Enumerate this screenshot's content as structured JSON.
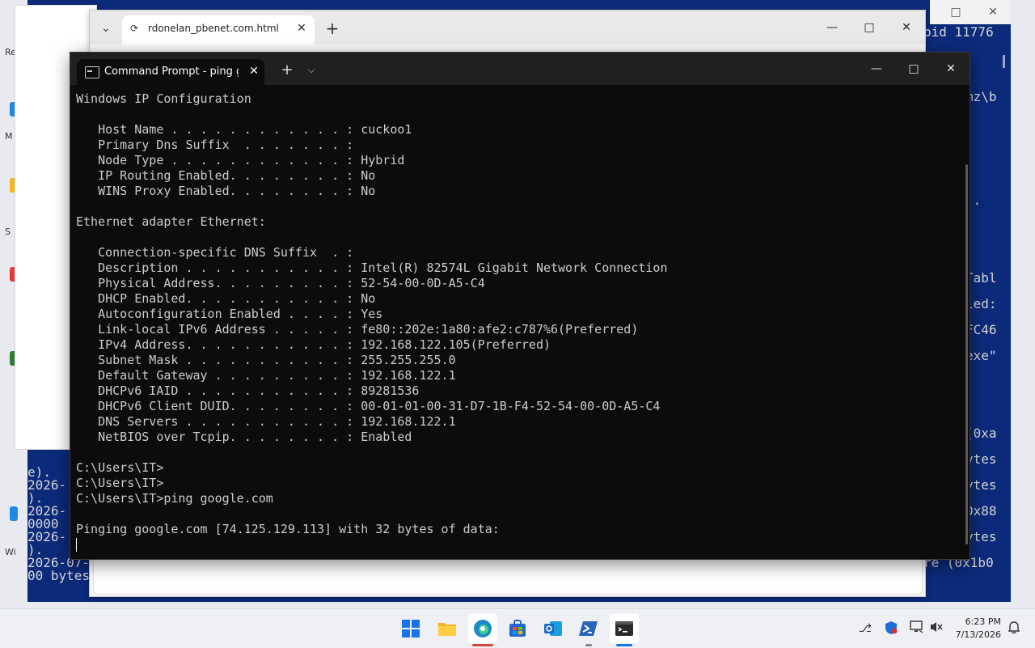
{
  "desktop": {
    "labels": [
      "Re",
      "M",
      "S",
      "Wi"
    ]
  },
  "background_terminal": {
    "right_fragments": [
      "pid 11776",
      "mz\\b",
      ".",
      "'.",
      "Tabl",
      "led:",
      "FC46",
      "exe\"",
      "(0xa",
      "ytes",
      "ytes",
      "0x88",
      "ytes",
      "re (0x1b0"
    ],
    "left_fragments": [
      "e).",
      "2026-",
      ").",
      "2026-",
      "0000",
      "2026-",
      ").",
      "2026-07-",
      "00 bytes"
    ],
    "controls": {
      "maximize": "□",
      "close": "✕"
    }
  },
  "browser": {
    "tab_title": "rdonelan_pbenet.com.html",
    "new_tab": "+",
    "dropdown": "⌄",
    "controls": {
      "minimize": "—",
      "maximize": "□",
      "close": "✕"
    }
  },
  "cmd": {
    "tab_title": "Command Prompt - ping google.com",
    "new_tab": "+",
    "dropdown": "⌄",
    "controls": {
      "minimize": "—",
      "maximize": "□",
      "close": "✕"
    },
    "lines": [
      "Windows IP Configuration",
      "",
      "   Host Name . . . . . . . . . . . . : cuckoo1",
      "   Primary Dns Suffix  . . . . . . . :",
      "   Node Type . . . . . . . . . . . . : Hybrid",
      "   IP Routing Enabled. . . . . . . . : No",
      "   WINS Proxy Enabled. . . . . . . . : No",
      "",
      "Ethernet adapter Ethernet:",
      "",
      "   Connection-specific DNS Suffix  . :",
      "   Description . . . . . . . . . . . : Intel(R) 82574L Gigabit Network Connection",
      "   Physical Address. . . . . . . . . : 52-54-00-0D-A5-C4",
      "   DHCP Enabled. . . . . . . . . . . : No",
      "   Autoconfiguration Enabled . . . . : Yes",
      "   Link-local IPv6 Address . . . . . : fe80::202e:1a80:afe2:c787%6(Preferred)",
      "   IPv4 Address. . . . . . . . . . . : 192.168.122.105(Preferred)",
      "   Subnet Mask . . . . . . . . . . . : 255.255.255.0",
      "   Default Gateway . . . . . . . . . : 192.168.122.1",
      "   DHCPv6 IAID . . . . . . . . . . . : 89281536",
      "   DHCPv6 Client DUID. . . . . . . . : 00-01-01-00-31-D7-1B-F4-52-54-00-0D-A5-C4",
      "   DNS Servers . . . . . . . . . . . : 192.168.122.1",
      "   NetBIOS over Tcpip. . . . . . . . : Enabled",
      "",
      "C:\\Users\\IT>",
      "C:\\Users\\IT>",
      "C:\\Users\\IT>ping google.com",
      "",
      "Pinging google.com [74.125.129.113] with 32 bytes of data:"
    ]
  },
  "taskbar": {
    "apps": [
      {
        "name": "start",
        "icon": "windows-logo-icon",
        "color": "#1a73e8"
      },
      {
        "name": "file-explorer",
        "icon": "folder-icon",
        "color": "#f2b51d"
      },
      {
        "name": "edge",
        "icon": "edge-icon",
        "color": "#1e88c8"
      },
      {
        "name": "store",
        "icon": "store-icon",
        "color": "#2266d6"
      },
      {
        "name": "outlook",
        "icon": "outlook-icon",
        "color": "#1b68c9"
      },
      {
        "name": "powershell",
        "icon": "powershell-icon",
        "color": "#2a64b8"
      },
      {
        "name": "terminal",
        "icon": "terminal-icon",
        "color": "#2b2b2b"
      }
    ],
    "clock": {
      "time": "6:23 PM",
      "date": "7/13/2026"
    }
  }
}
